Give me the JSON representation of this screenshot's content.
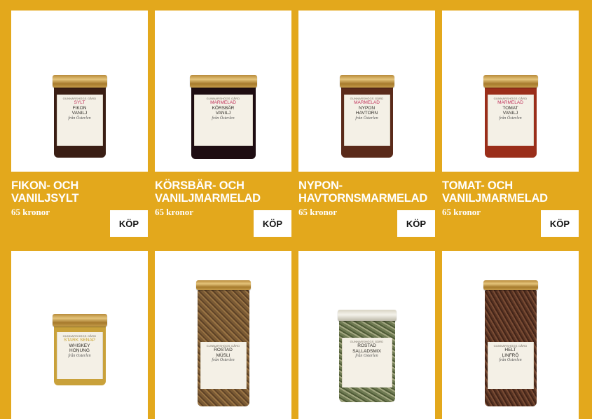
{
  "products": [
    {
      "title": "FIKON- OCH VANILJSYLT",
      "price": "65 kronor",
      "buy_label": "KÖP",
      "jar_label": {
        "brand": "GUNNARSHÖGS GÅRD",
        "kind": "SYLT",
        "line1": "FIKON",
        "line2": "VANILJ",
        "sub": "från Österlen"
      },
      "fill_color": "#3a1e14"
    },
    {
      "title": "KÖRSBÄR- OCH VANILJMARMELAD",
      "price": "65 kronor",
      "buy_label": "KÖP",
      "jar_label": {
        "brand": "GUNNARSHÖGS GÅRD",
        "kind": "MARMELAD",
        "line1": "KÖRSBÄR",
        "line2": "VANILJ",
        "sub": "från Österlen"
      },
      "fill_color": "#1e0d12"
    },
    {
      "title": "NYPON- HAVTORNSMARMELAD",
      "price": "65 kronor",
      "buy_label": "KÖP",
      "jar_label": {
        "brand": "GUNNARSHÖGS GÅRD",
        "kind": "MARMELAD",
        "line1": "NYPON",
        "line2": "HAVTORN",
        "sub": "från Österlen"
      },
      "fill_color": "#5a2a1a"
    },
    {
      "title": "TOMAT- OCH VANILJMARMELAD",
      "price": "65 kronor",
      "buy_label": "KÖP",
      "jar_label": {
        "brand": "GUNNARSHÖGS GÅRD",
        "kind": "MARMELAD",
        "line1": "TOMAT",
        "line2": "VANILJ",
        "sub": "från Österlen"
      },
      "fill_color": "#9a2e1a"
    },
    {
      "jar_label": {
        "brand": "GUNNARSHÖGS GÅRD",
        "kind": "STARK SENAP",
        "line1": "WHISKEY",
        "line2": "HONUNG",
        "sub": "från Österlen"
      },
      "fill_color": "#c9a13a"
    },
    {
      "jar_label": {
        "brand": "GUNNARSHÖGS GÅRD",
        "kind": "",
        "line1": "ROSTAD",
        "line2": "MÜSLI",
        "sub": "från Österlen"
      },
      "fill_color": "#7a5a34"
    },
    {
      "jar_label": {
        "brand": "GUNNARSHÖGS GÅRD",
        "kind": "",
        "line1": "ROSTAD",
        "line2": "SALLADSMIX",
        "sub": "från Österlen"
      },
      "fill_color": "#6e7a52"
    },
    {
      "jar_label": {
        "brand": "GUNNARSHÖGS GÅRD",
        "kind": "",
        "line1": "HELT",
        "line2": "LINFRÖ",
        "sub": "från Österlen"
      },
      "fill_color": "#5a3524"
    }
  ]
}
